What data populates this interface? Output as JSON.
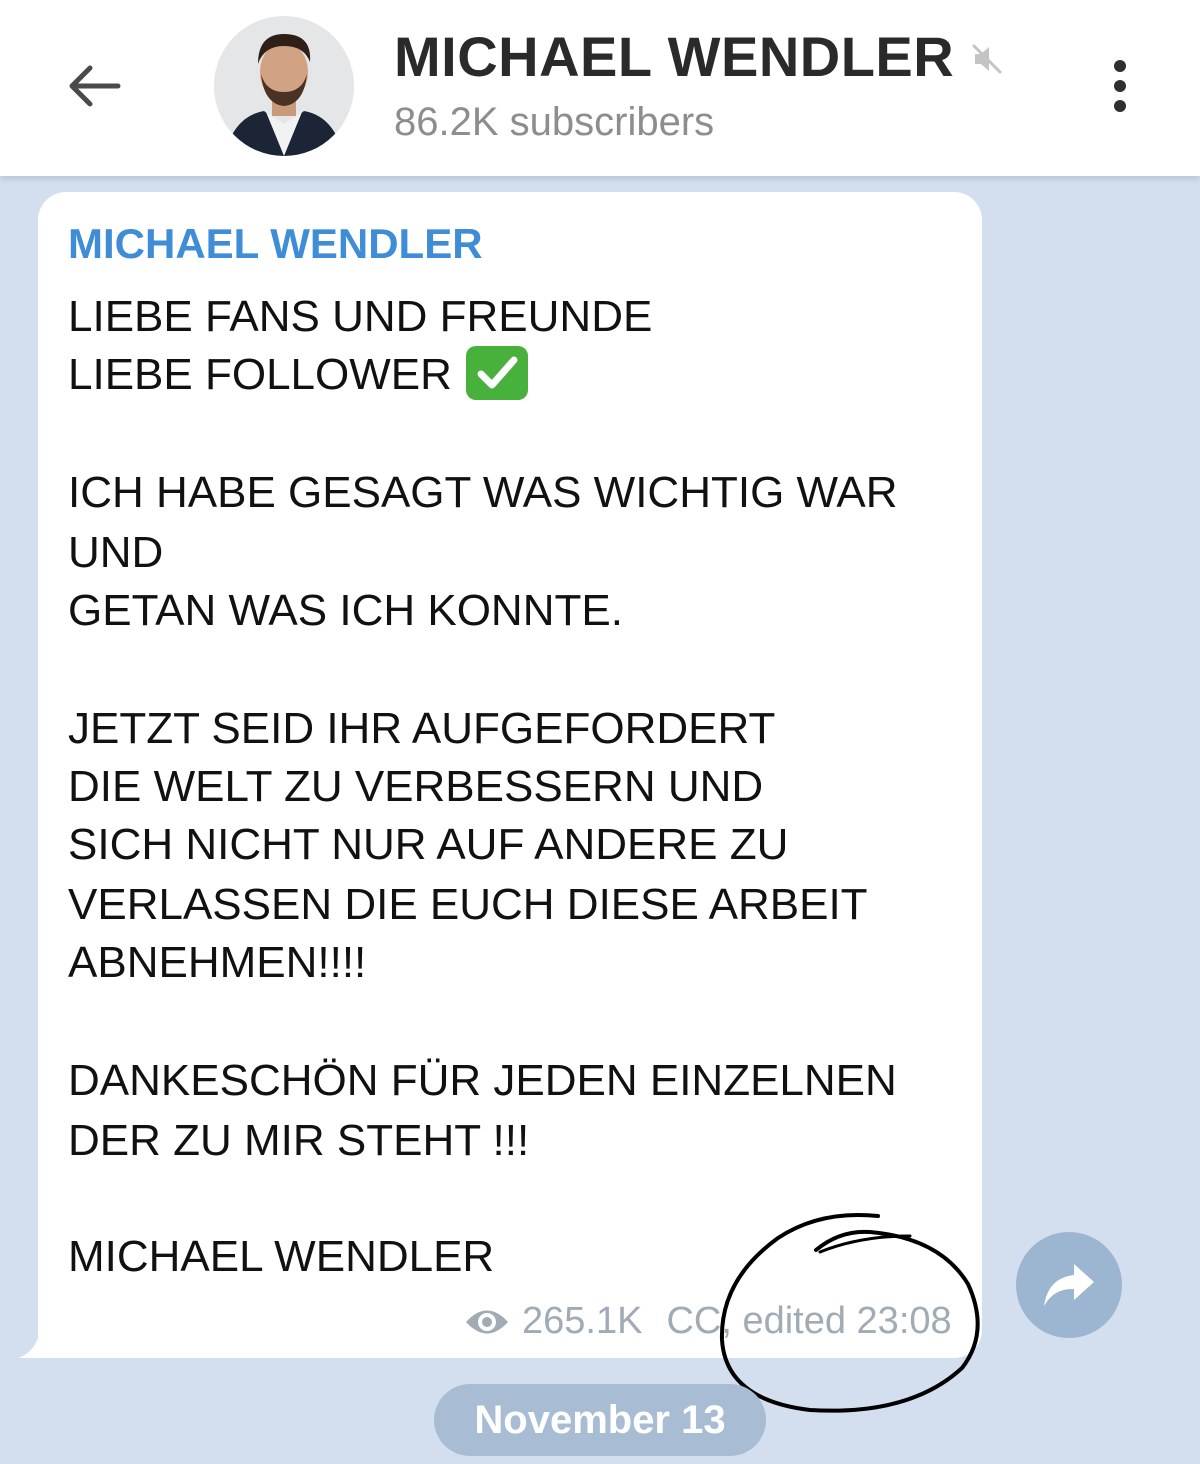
{
  "header": {
    "channel_name": "MICHAEL WENDLER",
    "subscribers": "86.2K subscribers",
    "icons": {
      "back": "arrow-left-icon",
      "muted": "speaker-muted-icon",
      "menu": "more-vertical-icon"
    }
  },
  "message": {
    "sender": "MICHAEL WENDLER",
    "lines": [
      "LIEBE FANS UND FREUNDE",
      "LIEBE FOLLOWER",
      "ICH HABE GESAGT WAS WICHTIG WAR",
      "UND",
      "GETAN WAS ICH KONNTE.",
      "JETZT SEID IHR AUFGEFORDERT",
      "DIE WELT ZU VERBESSERN UND",
      "SICH NICHT NUR AUF ANDERE ZU",
      "VERLASSEN DIE EUCH DIESE ARBEIT",
      "ABNEHMEN!!!!",
      "DANKESCHÖN FÜR JEDEN EINZELNEN",
      "DER ZU MIR STEHT !!!",
      "MICHAEL WENDLER"
    ],
    "emoji": "check-mark-button-emoji",
    "views": "265.1K",
    "author_signature": "CC",
    "edited_time": ", edited 23:08"
  },
  "share_icon": "share-arrow-icon",
  "date_separator": "November 13",
  "colors": {
    "background": "#d3dfee",
    "sender_name": "#3e8dd6",
    "meta_text": "#a0abb6",
    "share_button": "#9cb5d0",
    "date_pill": "#a8bdd4"
  }
}
